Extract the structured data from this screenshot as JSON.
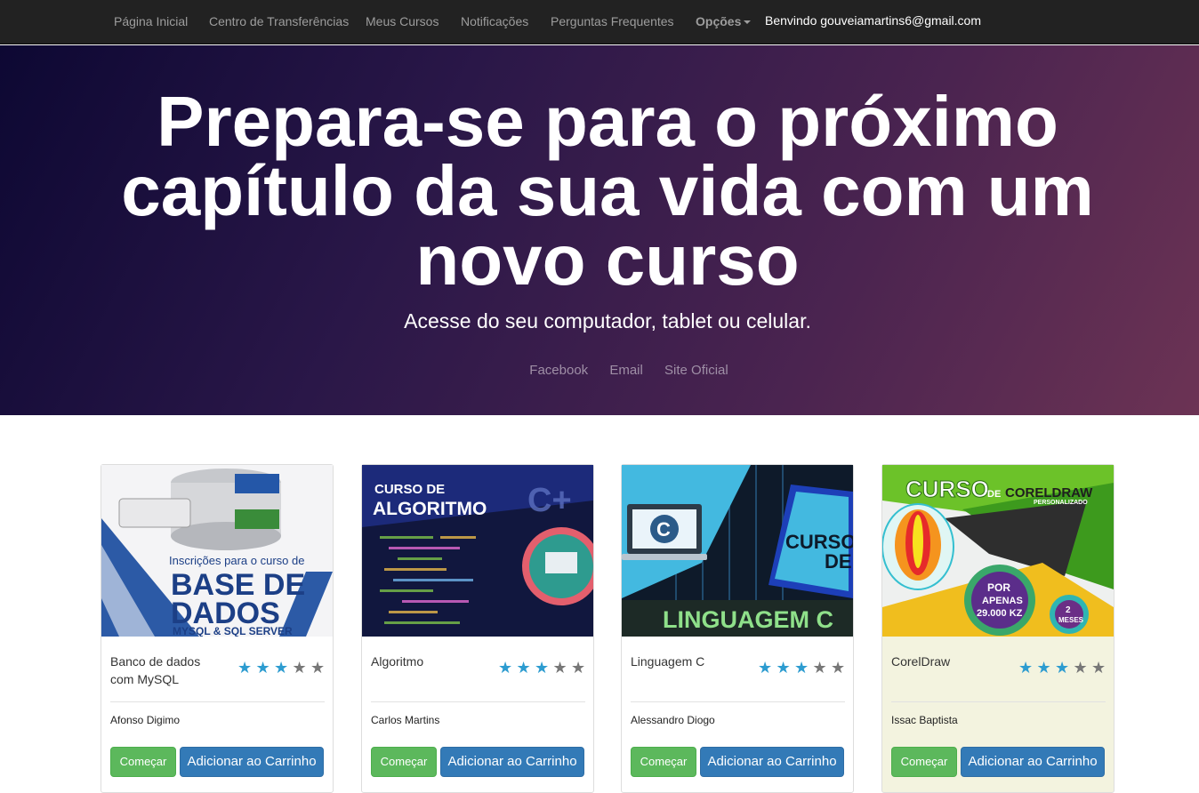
{
  "nav": {
    "items": [
      {
        "label": "Página Inicial"
      },
      {
        "label": "Centro de Transferências"
      },
      {
        "label": "Meus Cursos"
      },
      {
        "label": "Notificações"
      },
      {
        "label": "Perguntas Frequentes"
      }
    ],
    "options_label": "Opções",
    "welcome": "Benvindo gouveiamartins6@gmail.com"
  },
  "hero": {
    "title": "Prepara-se para o próximo capítulo da sua vida com um novo curso",
    "subtitle": "Acesse do seu computador, tablet ou celular.",
    "links": [
      {
        "label": "Facebook"
      },
      {
        "label": "Email"
      },
      {
        "label": "Site Oficial"
      }
    ]
  },
  "courses": [
    {
      "title": "Banco de dados com MySQL",
      "author": "Afonso Digimo",
      "rating": 3,
      "rating_max": 5,
      "start_label": "Começar",
      "cart_label": "Adicionar ao Carrinho",
      "image_text": {
        "line1": "Inscrições para o curso de",
        "line2": "BASE DE",
        "line3": "DADOS",
        "line4": "MYSQL & SQL SERVER"
      }
    },
    {
      "title": "Algoritmo",
      "author": "Carlos Martins",
      "rating": 3,
      "rating_max": 5,
      "start_label": "Começar",
      "cart_label": "Adicionar ao Carrinho",
      "image_text": {
        "line1": "CURSO DE",
        "line2": "ALGORITMO",
        "line3": "C+"
      }
    },
    {
      "title": "Linguagem C",
      "author": "Alessandro Diogo",
      "rating": 3,
      "rating_max": 5,
      "start_label": "Começar",
      "cart_label": "Adicionar ao Carrinho",
      "image_text": {
        "line1": "CURSO",
        "line2": "DE",
        "line3": "LINGUAGEM C",
        "line4": "C"
      }
    },
    {
      "title": "CorelDraw",
      "author": "Issac Baptista",
      "rating": 3,
      "rating_max": 5,
      "start_label": "Começar",
      "cart_label": "Adicionar ao Carrinho",
      "image_text": {
        "line1": "CURSO",
        "line2": "DE",
        "line3": "CORELDRAW",
        "line4": "PERSONALIZADO",
        "line5": "POR",
        "line6": "APENAS",
        "line7": "29.000 KZ",
        "line8": "2",
        "line9": "MESES"
      }
    }
  ],
  "colors": {
    "navbar_bg": "#222222",
    "star_active": "#2d9cd0",
    "star_inactive": "#777777",
    "start_button": "#5cb85c",
    "cart_button": "#337ab7"
  }
}
